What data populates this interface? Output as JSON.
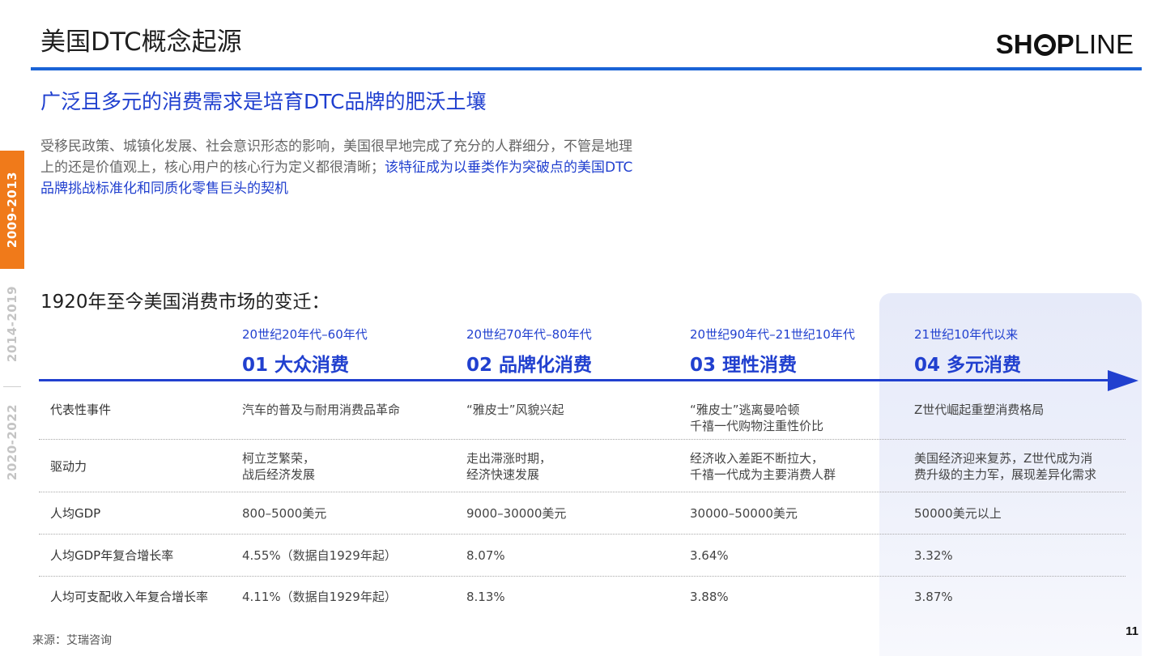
{
  "header": {
    "title": "美国DTC概念起源",
    "logo_bold_left": "SH",
    "logo_bold_right": "P",
    "logo_light": "LINE"
  },
  "subtitle": "广泛且多元的消费需求是培育DTC品牌的肥沃土壤",
  "intro": {
    "text_normal": "受移民政策、城镇化发展、社会意识形态的影响，美国很早地完成了充分的人群细分，不管是地理上的还是价值观上，核心用户的核心行为定义都很清晰；",
    "text_highlight": "该特征成为以垂类作为突破点的美国DTC品牌挑战标准化和同质化零售巨头的契机"
  },
  "side_tabs": [
    {
      "label": "2009-2013",
      "active": true
    },
    {
      "label": "2014-2019",
      "active": false
    },
    {
      "label": "2020-2022",
      "active": false
    }
  ],
  "section_heading": "1920年至今美国消费市场的变迁：",
  "eras": [
    {
      "period": "20世纪20年代–60年代",
      "label": "01 大众消费"
    },
    {
      "period": "20世纪70年代–80年代",
      "label": "02 品牌化消费"
    },
    {
      "period": "20世纪90年代–21世纪10年代",
      "label": "03 理性消费"
    },
    {
      "period": "21世纪10年代以来",
      "label": "04 多元消费"
    }
  ],
  "rows": [
    {
      "label": "代表性事件",
      "cells": [
        [
          "汽车的普及与耐用消费品革命"
        ],
        [
          "“雅皮士”风貌兴起"
        ],
        [
          "“雅皮士”逃离曼哈顿",
          "千禧一代购物注重性价比"
        ],
        [
          "Z世代崛起重塑消费格局"
        ]
      ]
    },
    {
      "label": "驱动力",
      "cells": [
        [
          "柯立芝繁荣，",
          "战后经济发展"
        ],
        [
          "走出滞涨时期，",
          "经济快速发展"
        ],
        [
          "经济收入差距不断拉大，",
          "千禧一代成为主要消费人群"
        ],
        [
          "美国经济迎来复苏，Z世代成为消",
          "费升级的主力军，展现差异化需求"
        ]
      ]
    },
    {
      "label": "人均GDP",
      "cells": [
        [
          "800–5000美元"
        ],
        [
          "9000–30000美元"
        ],
        [
          "30000–50000美元"
        ],
        [
          "50000美元以上"
        ]
      ]
    },
    {
      "label": "人均GDP年复合增长率",
      "cells": [
        [
          "4.55%（数据自1929年起）"
        ],
        [
          "8.07%"
        ],
        [
          "3.64%"
        ],
        [
          "3.32%"
        ]
      ]
    },
    {
      "label": "人均可支配收入年复合增长率",
      "cells": [
        [
          "4.11%（数据自1929年起）"
        ],
        [
          "8.13%"
        ],
        [
          "3.88%"
        ],
        [
          "3.87%"
        ]
      ]
    }
  ],
  "footer": {
    "source": "来源：艾瑞咨询",
    "page_number": "11"
  },
  "colors": {
    "accent_blue": "#2140cf",
    "rule_blue": "#1a63d6",
    "tab_orange": "#f07a1a"
  }
}
